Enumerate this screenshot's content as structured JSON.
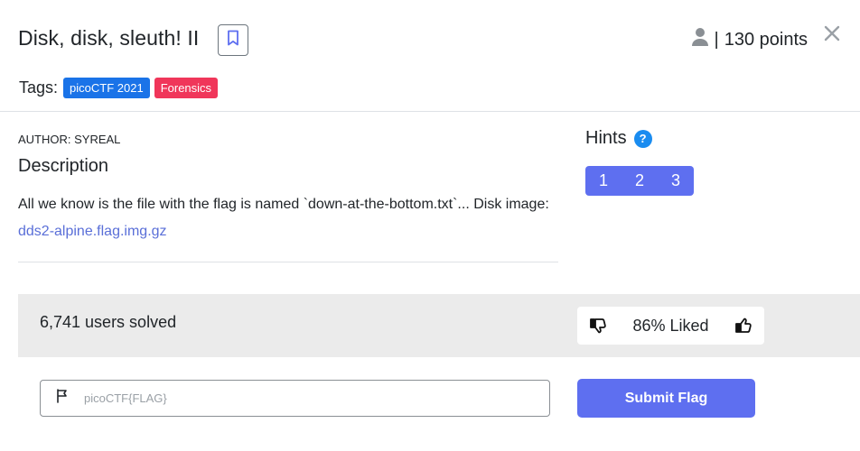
{
  "challenge": {
    "title": "Disk, disk, sleuth! II",
    "points_separator": "|",
    "points": "130 points"
  },
  "tags": {
    "label": "Tags:",
    "items": [
      {
        "label": "picoCTF 2021",
        "color": "#1a73e8"
      },
      {
        "label": "Forensics",
        "color": "#f0365a"
      }
    ]
  },
  "author": "AUTHOR: SYREAL",
  "description": {
    "heading": "Description",
    "text": "All we know is the file with the flag is named `down-at-the-bottom.txt`... Disk image: ",
    "link_text": "dds2-alpine.flag.img.gz"
  },
  "hints": {
    "heading": "Hints",
    "help_glyph": "?",
    "buttons": [
      "1",
      "2",
      "3"
    ]
  },
  "stats": {
    "solved": "6,741 users solved",
    "liked": "86% Liked"
  },
  "flag_form": {
    "placeholder": "picoCTF{FLAG}",
    "submit_label": "Submit Flag"
  },
  "icons": {
    "bookmark": "bookmark-icon",
    "user": "user-icon",
    "close": "close-icon",
    "flag": "flag-icon",
    "thumbs_down": "thumbs-down-icon",
    "thumbs_up": "thumbs-up-icon"
  },
  "colors": {
    "accent": "#5e6ff0",
    "link": "#5a6fd8",
    "hint_help": "#1a8cf0"
  }
}
